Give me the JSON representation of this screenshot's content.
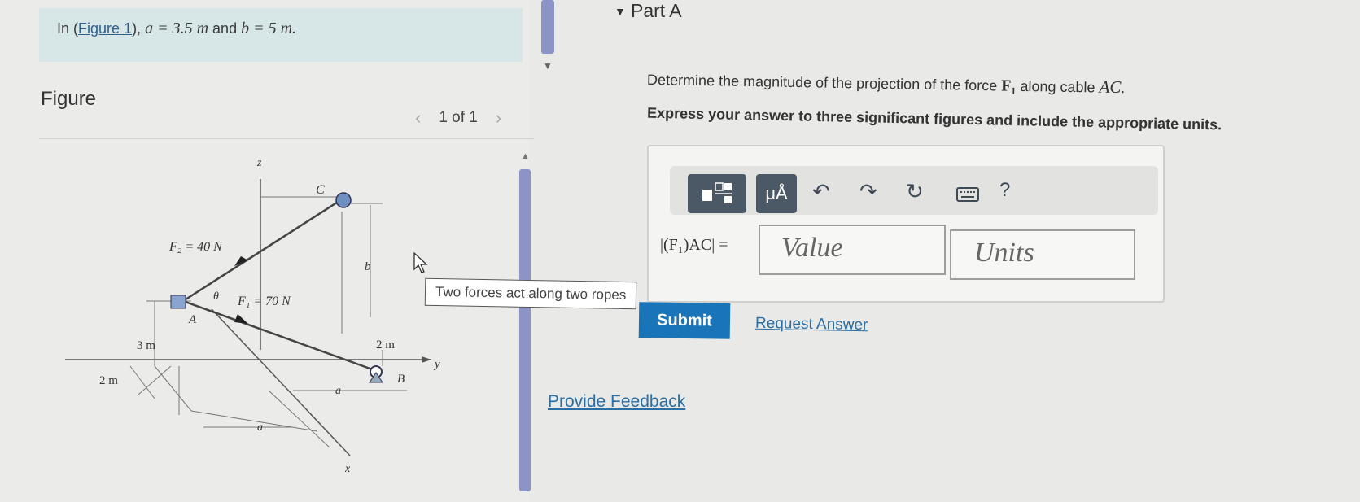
{
  "intro": {
    "prefix": "In (",
    "figure_link": "Figure 1",
    "suffix": "),",
    "a_text": "a = 3.5 m",
    "and_text": "and",
    "b_text": "b = 5 m."
  },
  "figure": {
    "label": "Figure",
    "pager": {
      "prev": "‹",
      "text": "1 of 1",
      "next": "›"
    },
    "tooltip": "Two forces act along two ropes",
    "labels": {
      "z": "z",
      "C": "C",
      "F2": "F₂ = 40 N",
      "b": "b",
      "theta": "θ",
      "F1": "F₁ = 70 N",
      "A": "A",
      "three_m": "3 m",
      "two_m_right": "2 m",
      "two_m_left": "2 m",
      "B": "B",
      "y": "y",
      "a1": "a",
      "a2": "a",
      "x": "x"
    }
  },
  "part": {
    "title": "Part A",
    "question_prefix": "Determine the magnitude of the projection of the force",
    "question_force": "F₁",
    "question_mid": "along cable",
    "question_cable": "AC.",
    "instructions": "Express your answer to three significant figures and include the appropriate units."
  },
  "answer": {
    "lhs": "|(F₁)AC| =",
    "value_placeholder": "Value",
    "units_placeholder": "Units",
    "toolbar": {
      "units_button": "μÅ",
      "help": "?"
    }
  },
  "actions": {
    "submit": "Submit",
    "request_answer": "Request Answer",
    "provide_feedback": "Provide Feedback"
  }
}
